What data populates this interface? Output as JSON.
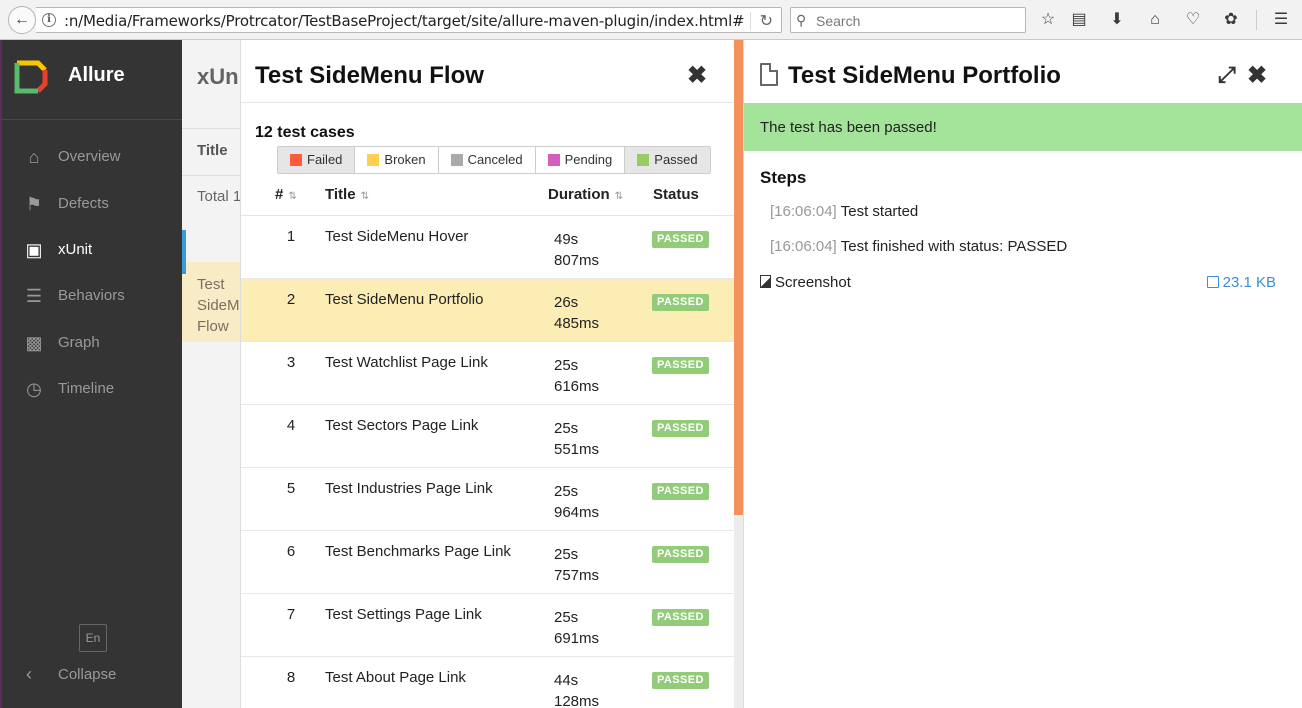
{
  "browser": {
    "url": ":n/Media/Frameworks/Protrcator/TestBaseProject/target/site/allure-maven-plugin/index.html#",
    "search_placeholder": "Search",
    "toolbar_icons": [
      "star-icon",
      "reading-list-icon",
      "download-icon",
      "home-icon",
      "pocket-icon",
      "extension-icon",
      "menu-icon"
    ]
  },
  "sidebar": {
    "brand": "Allure",
    "logo_colors": [
      "#f7c800",
      "#e8402a",
      "#59b96c"
    ],
    "items": [
      {
        "label": "Overview",
        "icon": "home-icon",
        "active": false
      },
      {
        "label": "Defects",
        "icon": "flag-icon",
        "active": false
      },
      {
        "label": "xUnit",
        "icon": "briefcase-icon",
        "active": true
      },
      {
        "label": "Behaviors",
        "icon": "list-icon",
        "active": false
      },
      {
        "label": "Graph",
        "icon": "bar-chart-icon",
        "active": false
      },
      {
        "label": "Timeline",
        "icon": "clock-icon",
        "active": false
      }
    ],
    "language": "En",
    "collapse": "Collapse"
  },
  "background_pane": {
    "title": "xUnit",
    "column": "Title",
    "total": "Total 1",
    "row_text": "Test SideMenu Flow"
  },
  "list_pane": {
    "title": "Test SideMenu Flow",
    "count": "12 test cases",
    "filters": [
      {
        "label": "Failed",
        "color": "#fd5a3e",
        "active": true
      },
      {
        "label": "Broken",
        "color": "#ffd050",
        "active": false
      },
      {
        "label": "Canceled",
        "color": "#aaaaaa",
        "active": false
      },
      {
        "label": "Pending",
        "color": "#d35ebe",
        "active": false
      },
      {
        "label": "Passed",
        "color": "#97cc64",
        "active": true
      }
    ],
    "headers": {
      "num": "#",
      "title": "Title",
      "duration": "Duration",
      "status": "Status"
    },
    "rows": [
      {
        "num": "1",
        "title": "Test SideMenu Hover",
        "dur1": "49s",
        "dur2": "807ms",
        "status": "PASSED"
      },
      {
        "num": "2",
        "title": "Test SideMenu Portfolio",
        "dur1": "26s",
        "dur2": "485ms",
        "status": "PASSED"
      },
      {
        "num": "3",
        "title": "Test Watchlist Page Link",
        "dur1": "25s",
        "dur2": "616ms",
        "status": "PASSED"
      },
      {
        "num": "4",
        "title": "Test Sectors Page Link",
        "dur1": "25s",
        "dur2": "551ms",
        "status": "PASSED"
      },
      {
        "num": "5",
        "title": "Test Industries Page Link",
        "dur1": "25s",
        "dur2": "964ms",
        "status": "PASSED"
      },
      {
        "num": "6",
        "title": "Test Benchmarks Page Link",
        "dur1": "25s",
        "dur2": "757ms",
        "status": "PASSED"
      },
      {
        "num": "7",
        "title": "Test Settings Page Link",
        "dur1": "25s",
        "dur2": "691ms",
        "status": "PASSED"
      },
      {
        "num": "8",
        "title": "Test About Page Link",
        "dur1": "44s",
        "dur2": "128ms",
        "status": "PASSED"
      }
    ]
  },
  "detail_pane": {
    "title": "Test SideMenu Portfolio",
    "status_message": "The test has been passed!",
    "steps_heading": "Steps",
    "steps": [
      {
        "time": "[16:06:04]",
        "text": "Test started"
      },
      {
        "time": "[16:06:04]",
        "text": "Test finished with status: PASSED"
      }
    ],
    "attachment": {
      "name": "Screenshot",
      "size": "23.1 KB"
    }
  }
}
